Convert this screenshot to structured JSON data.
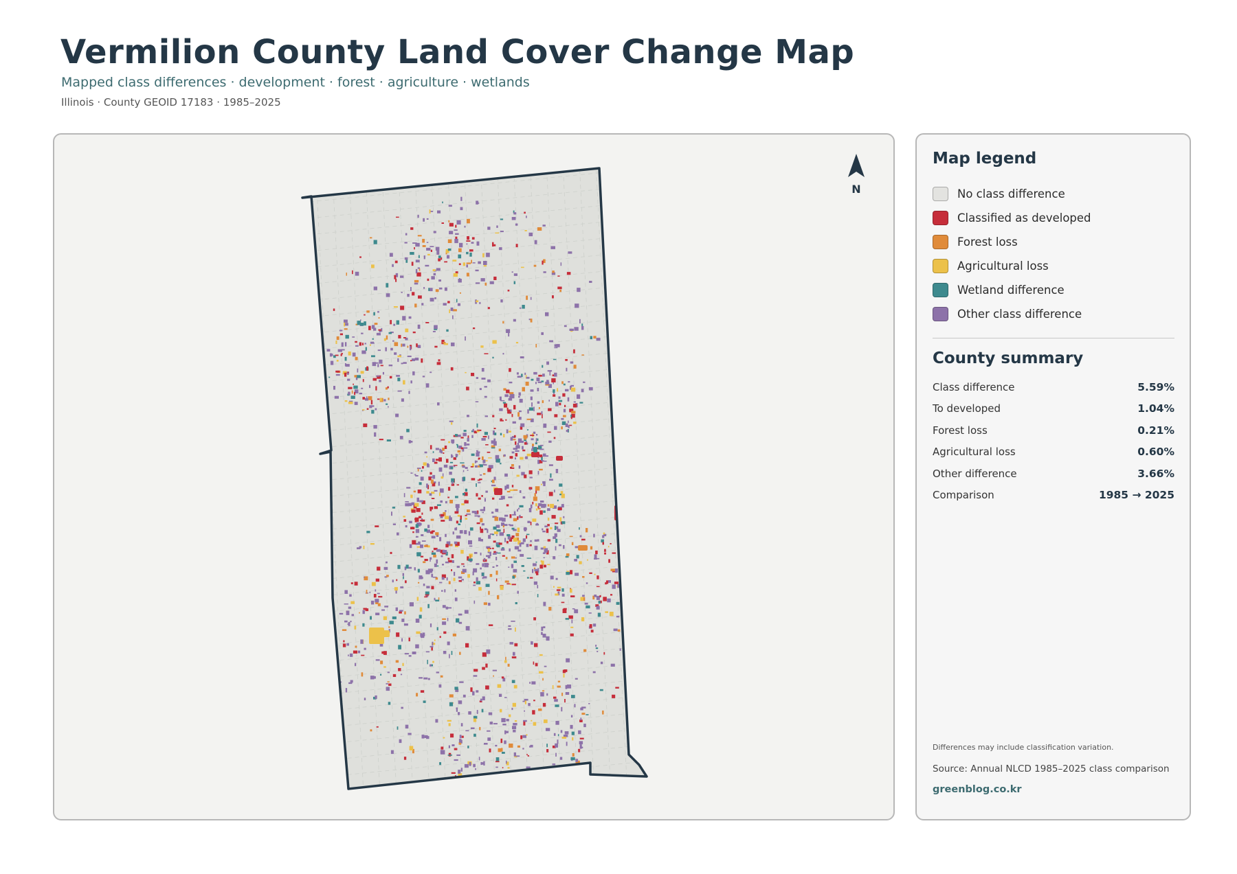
{
  "header": {
    "title": "Vermilion County Land Cover Change Map",
    "subtitle": "Mapped class differences · development · forest · agriculture · wetlands",
    "meta": "Illinois · County GEOID 17183 · 1985–2025"
  },
  "map": {
    "north_arrow_label": "N",
    "north_arrow_icon": "north-arrow-icon"
  },
  "colors": {
    "no_change": "#dfe0dc",
    "developed": "#c62d3a",
    "forest_loss": "#e08b3a",
    "agricultural_loss": "#ecc14a",
    "wetland": "#3e8a8e",
    "other": "#8d72a9",
    "outline": "#243746"
  },
  "legend": {
    "heading": "Map legend",
    "items": [
      {
        "label": "No class difference",
        "color": "#e3e3e0"
      },
      {
        "label": "Classified as developed",
        "color": "#c62d3a"
      },
      {
        "label": "Forest loss",
        "color": "#e08b3a"
      },
      {
        "label": "Agricultural loss",
        "color": "#ecc14a"
      },
      {
        "label": "Wetland difference",
        "color": "#3e8a8e"
      },
      {
        "label": "Other class difference",
        "color": "#8d72a9"
      }
    ]
  },
  "summary": {
    "heading": "County summary",
    "rows": [
      {
        "label": "Class difference",
        "value": "5.59%"
      },
      {
        "label": "To developed",
        "value": "1.04%"
      },
      {
        "label": "Forest loss",
        "value": "0.21%"
      },
      {
        "label": "Agricultural loss",
        "value": "0.60%"
      },
      {
        "label": "Other difference",
        "value": "3.66%"
      },
      {
        "label": "Comparison",
        "value": "1985 → 2025"
      }
    ]
  },
  "footer": {
    "note": "Differences may include classification variation.",
    "source": "Source: Annual NLCD 1985–2025 class comparison",
    "credit": "greenblog.co.kr"
  }
}
